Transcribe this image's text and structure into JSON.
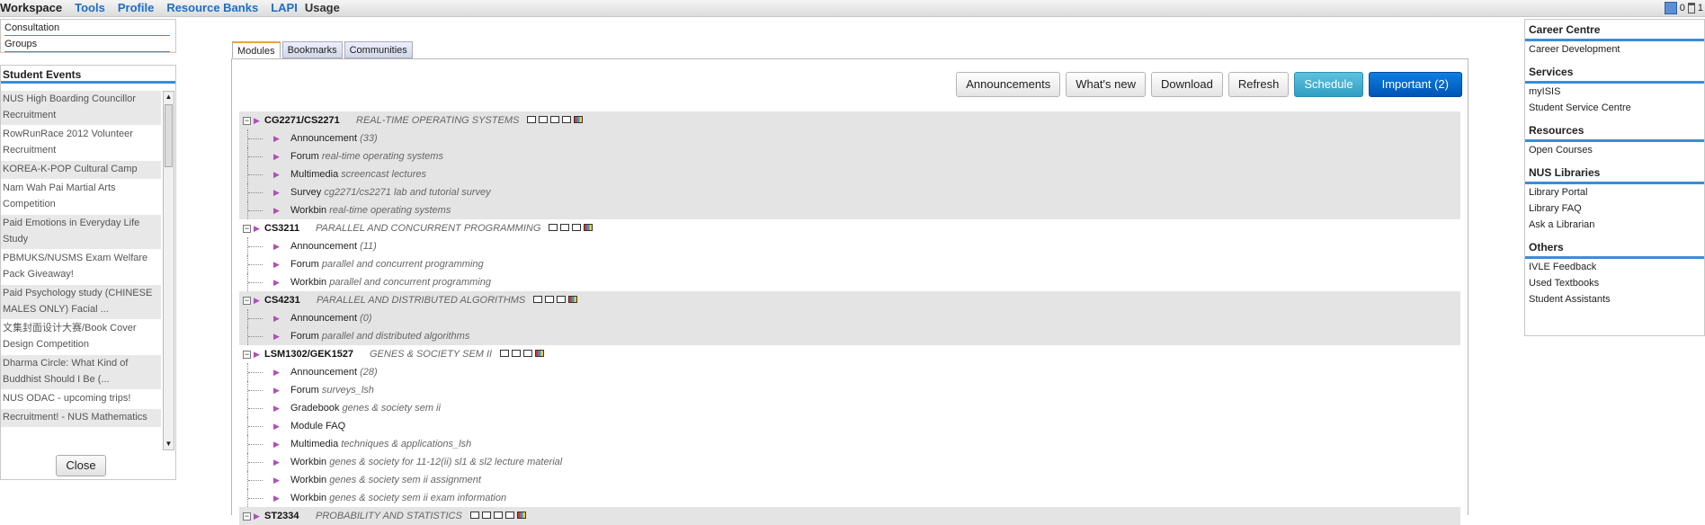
{
  "topnav": [
    "Workspace",
    "Tools",
    "Profile",
    "Resource Banks",
    "LAPI",
    "Usage"
  ],
  "tray": {
    "mail_count": "0",
    "trash_count": "1"
  },
  "left_links": [
    "Consultation",
    "Groups"
  ],
  "student_events": {
    "title": "Student Events",
    "items": [
      "NUS High Boarding Councillor Recruitment",
      "RowRunRace 2012 Volunteer Recruitment",
      "KOREA-K-POP Cultural Camp",
      "Nam Wah Pai Martial Arts Competition",
      "Paid Emotions in Everyday Life Study",
      "PBMUKS/NUSMS Exam Welfare Pack Giveaway!",
      "Paid Psychology study (CHINESE MALES ONLY) Facial ...",
      "文集封面设计大赛/Book Cover Design Competition",
      "Dharma Circle: What Kind of Buddhist Should I Be (...",
      "NUS ODAC - upcoming trips!",
      "Recruitment! - NUS Mathematics"
    ],
    "close_label": "Close"
  },
  "tabs": [
    "Modules",
    "Bookmarks",
    "Communities"
  ],
  "actions": [
    "Announcements",
    "What's new",
    "Download",
    "Refresh",
    "Schedule",
    "Important (2)"
  ],
  "modules": [
    {
      "code": "CG2271/CS2271",
      "title": "REAL-TIME OPERATING SYSTEMS",
      "shaded": true,
      "icons": 5,
      "items": [
        {
          "label": "Announcement",
          "desc": "(33)"
        },
        {
          "label": "Forum",
          "desc": "real-time operating systems"
        },
        {
          "label": "Multimedia",
          "desc": "screencast lectures"
        },
        {
          "label": "Survey",
          "desc": "cg2271/cs2271 lab and tutorial survey"
        },
        {
          "label": "Workbin",
          "desc": "real-time operating systems"
        }
      ]
    },
    {
      "code": "CS3211",
      "title": "PARALLEL AND CONCURRENT PROGRAMMING",
      "shaded": false,
      "icons": 4,
      "items": [
        {
          "label": "Announcement",
          "desc": "(11)"
        },
        {
          "label": "Forum",
          "desc": "parallel and concurrent programming"
        },
        {
          "label": "Workbin",
          "desc": "parallel and concurrent programming"
        }
      ]
    },
    {
      "code": "CS4231",
      "title": "PARALLEL AND DISTRIBUTED ALGORITHMS",
      "shaded": true,
      "icons": 4,
      "items": [
        {
          "label": "Announcement",
          "desc": "(0)"
        },
        {
          "label": "Forum",
          "desc": "parallel and distributed algorithms"
        }
      ]
    },
    {
      "code": "LSM1302/GEK1527",
      "title": "GENES & SOCIETY SEM II",
      "shaded": false,
      "icons": 4,
      "items": [
        {
          "label": "Announcement",
          "desc": "(28)"
        },
        {
          "label": "Forum",
          "desc": "surveys_lsh"
        },
        {
          "label": "Gradebook",
          "desc": "genes & society sem ii"
        },
        {
          "label": "Module FAQ",
          "desc": ""
        },
        {
          "label": "Multimedia",
          "desc": "techniques & applications_lsh"
        },
        {
          "label": "Workbin",
          "desc": "genes & society for 11-12(ii) sl1 & sl2 lecture material"
        },
        {
          "label": "Workbin",
          "desc": "genes & society sem ii assignment"
        },
        {
          "label": "Workbin",
          "desc": "genes & society sem ii exam information"
        }
      ]
    },
    {
      "code": "ST2334",
      "title": "PROBABILITY AND STATISTICS",
      "shaded": true,
      "icons": 5,
      "items": []
    }
  ],
  "right_sections": [
    {
      "title": "Career Centre",
      "items": [
        "Career Development"
      ]
    },
    {
      "title": "Services",
      "items": [
        "myISIS",
        "Student Service Centre"
      ]
    },
    {
      "title": "Resources",
      "items": [
        "Open Courses"
      ]
    },
    {
      "title": "NUS Libraries",
      "items": [
        "Library Portal",
        "Library FAQ",
        "Ask a Librarian"
      ]
    },
    {
      "title": "Others",
      "items": [
        "IVLE Feedback",
        "Used Textbooks",
        "Student Assistants"
      ]
    }
  ]
}
